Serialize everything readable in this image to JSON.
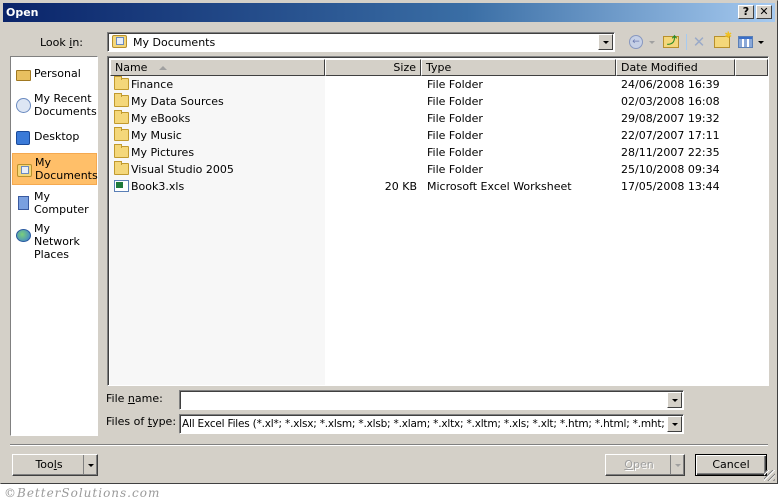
{
  "window": {
    "title": "Open",
    "help_button": "?",
    "close_button": "✕"
  },
  "lookin": {
    "label_pre": "Look ",
    "label_u": "i",
    "label_post": "n:",
    "value": "My Documents",
    "icon": "my-documents-icon"
  },
  "toolbar": {
    "back": "back-icon",
    "up": "up-folder-icon",
    "delete": "delete-icon",
    "new_folder": "new-folder-icon",
    "views": "views-icon"
  },
  "sidebar": {
    "items": [
      {
        "label": "Personal",
        "icon": "personal-folder-icon",
        "selected": false
      },
      {
        "label": "My Recent Documents",
        "icon": "recent-documents-icon",
        "selected": false
      },
      {
        "label": "Desktop",
        "icon": "desktop-icon",
        "selected": false
      },
      {
        "label": "My Documents",
        "icon": "my-documents-icon",
        "selected": true
      },
      {
        "label": "My Computer",
        "icon": "my-computer-icon",
        "selected": false
      },
      {
        "label": "My Network Places",
        "icon": "network-places-icon",
        "selected": false
      }
    ],
    "selected_color": "#ffbf69"
  },
  "filelist": {
    "columns": [
      {
        "label": "Name",
        "sorted": "ascending"
      },
      {
        "label": "Size"
      },
      {
        "label": "Type"
      },
      {
        "label": "Date Modified"
      }
    ],
    "rows": [
      {
        "name": "Finance",
        "size": "",
        "type": "File Folder",
        "date": "24/06/2008 16:39",
        "icon": "folder-icon"
      },
      {
        "name": "My Data Sources",
        "size": "",
        "type": "File Folder",
        "date": "02/03/2008 16:08",
        "icon": "data-sources-folder-icon"
      },
      {
        "name": "My eBooks",
        "size": "",
        "type": "File Folder",
        "date": "29/08/2007 19:32",
        "icon": "folder-icon"
      },
      {
        "name": "My Music",
        "size": "",
        "type": "File Folder",
        "date": "22/07/2007 17:11",
        "icon": "music-folder-icon"
      },
      {
        "name": "My Pictures",
        "size": "",
        "type": "File Folder",
        "date": "28/11/2007 22:35",
        "icon": "pictures-folder-icon"
      },
      {
        "name": "Visual Studio 2005",
        "size": "",
        "type": "File Folder",
        "date": "25/10/2008 09:34",
        "icon": "folder-icon"
      },
      {
        "name": "Book3.xls",
        "size": "20 KB",
        "type": "Microsoft Excel Worksheet",
        "date": "17/05/2008 13:44",
        "icon": "excel-file-icon"
      }
    ]
  },
  "filename": {
    "label_pre": "File ",
    "label_u": "n",
    "label_post": "ame:",
    "value": ""
  },
  "filetype": {
    "label_pre": "Files of ",
    "label_u": "t",
    "label_post": "ype:",
    "value": "All Excel Files (*.xl*; *.xlsx; *.xlsm; *.xlsb; *.xlam; *.xltx; *.xltm; *.xls; *.xlt; *.htm; *.html; *.mht;"
  },
  "buttons": {
    "tools_pre": "Too",
    "tools_u": "l",
    "tools_post": "s",
    "open_u": "O",
    "open_post": "pen",
    "cancel": "Cancel"
  },
  "footer": {
    "watermark": "©BetterSolutions.com"
  }
}
